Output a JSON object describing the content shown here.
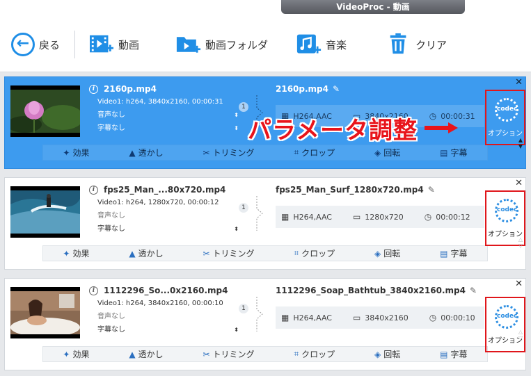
{
  "window": {
    "title": "VideoProc - 動画"
  },
  "toolbar": {
    "back_label": "戻る",
    "video_label": "動画",
    "folder_label": "動画フォルダ",
    "music_label": "音楽",
    "clear_label": "クリア"
  },
  "annotation": {
    "text": "パラメータ調整"
  },
  "tools": {
    "effect": "効果",
    "watermark": "透かし",
    "trim": "トリミング",
    "crop": "クロップ",
    "rotate": "回転",
    "subtitle": "字幕"
  },
  "option_label": "オプション",
  "codec_label": "codec",
  "items": [
    {
      "source_name": "2160p.mp4",
      "video_track": "Video1: h264, 3840x2160, 00:00:31",
      "audio_track": "音声なし",
      "subtitle_track": "字幕なし",
      "track_count": "1",
      "output_name": "2160p.mp4",
      "codec": "H264,AAC",
      "resolution": "3840x2160",
      "duration": "00:00:31"
    },
    {
      "source_name": "fps25_Man_...80x720.mp4",
      "video_track": "Video1: h264, 1280x720, 00:00:12",
      "audio_track": "音声なし",
      "subtitle_track": "字幕なし",
      "track_count": "1",
      "output_name": "fps25_Man_Surf_1280x720.mp4",
      "codec": "H264,AAC",
      "resolution": "1280x720",
      "duration": "00:00:12"
    },
    {
      "source_name": "1112296_So...0x2160.mp4",
      "video_track": "Video1: h264, 3840x2160, 00:00:10",
      "audio_track": "音声なし",
      "subtitle_track": "字幕なし",
      "track_count": "1",
      "output_name": "1112296_Soap_Bathtub_3840x2160.mp4",
      "codec": "H264,AAC",
      "resolution": "3840x2160",
      "duration": "00:00:10"
    }
  ]
}
